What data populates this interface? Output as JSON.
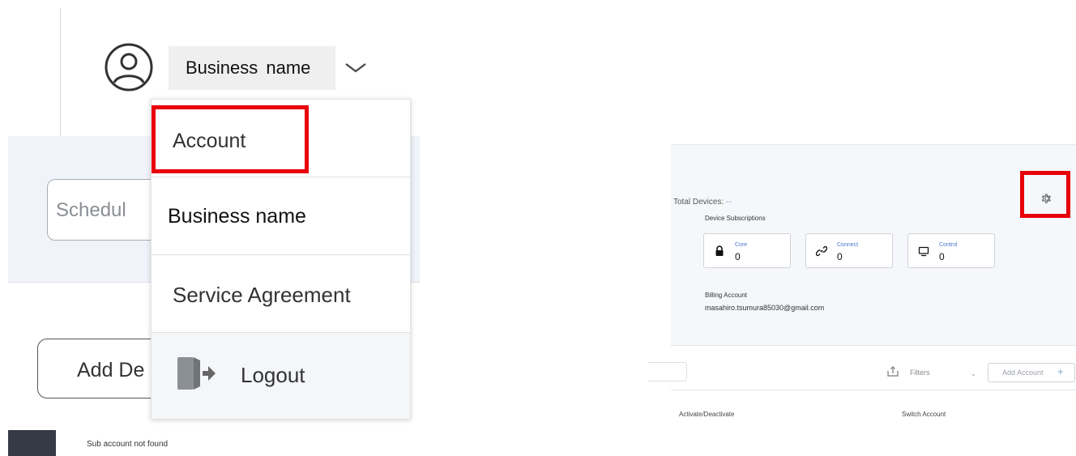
{
  "header": {
    "business_name": "Business name"
  },
  "account_menu": {
    "items": [
      {
        "label": "Account"
      },
      {
        "label": "Business name"
      },
      {
        "label": "Service Agreement"
      },
      {
        "label": "Logout"
      }
    ]
  },
  "background_page": {
    "schedule_input_text": "Schedul",
    "add_device_button": "Add De",
    "sub_account_message": "Sub account not found"
  },
  "devices_panel": {
    "total_devices_label": "Total Devices:",
    "total_devices_value": "--",
    "device_subscriptions_label": "Device Subscriptions",
    "subscriptions": [
      {
        "name": "Core",
        "value": "0",
        "icon": "lock-icon"
      },
      {
        "name": "Connect",
        "value": "0",
        "icon": "link-icon"
      },
      {
        "name": "Control",
        "value": "0",
        "icon": "monitor-icon"
      }
    ],
    "billing_account_label": "Billing Account",
    "billing_account_email": "masahiro.tsumura85030@gmail.com",
    "filters_label": "Filters",
    "add_account_label": "Add Account",
    "add_account_plus": "+",
    "columns": [
      "Activate/Deactivate",
      "Switch Account"
    ]
  },
  "colors": {
    "highlight_red": "#e8000b",
    "link_blue": "#4a74c9",
    "band_bg": "#f0f3f9"
  }
}
